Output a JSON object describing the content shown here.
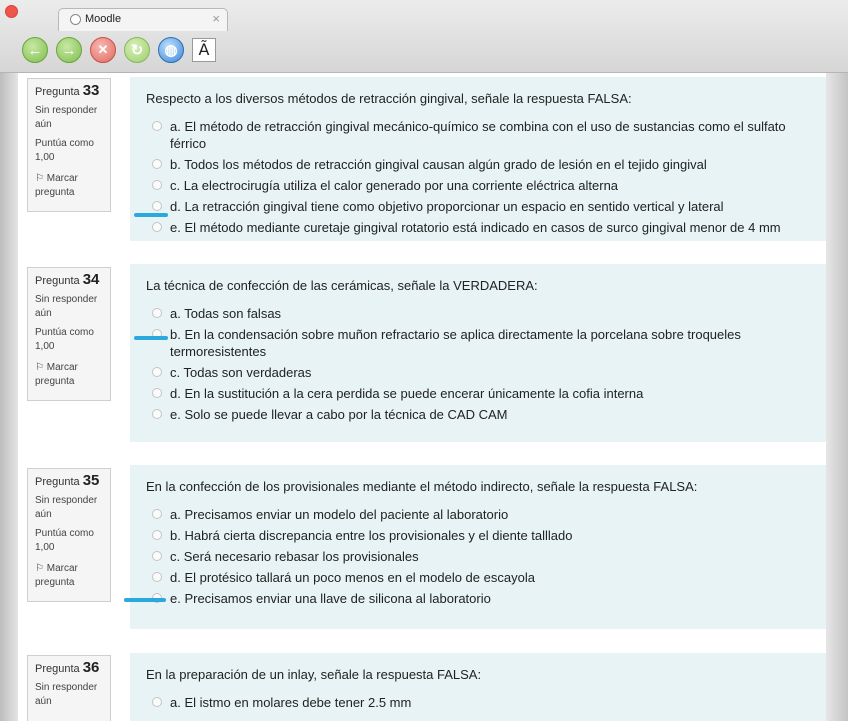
{
  "browser": {
    "tab_title": "Moodle",
    "font_button": "Ã"
  },
  "questions": [
    {
      "label": "Pregunta",
      "number": "33",
      "status": "Sin responder aún",
      "points": "Puntúa como 1,00",
      "flag": "Marcar pregunta",
      "text": "Respecto a los diversos métodos de retracción gingival, señale la respuesta FALSA:",
      "options": [
        "a. El método de retracción gingival mecánico-químico se combina con el uso de sustancias como el sulfato férrico",
        "b. Todos los métodos de retracción gingival causan algún grado de lesión en el tejido gingival",
        "c. La electrocirugía utiliza el calor generado por una corriente eléctrica alterna",
        "d. La retracción gingival tiene como objetivo proporcionar un espacio en sentido vertical y lateral",
        "e. El método mediante curetaje gingival rotatorio está indicado en casos de surco gingival menor de 4 mm"
      ]
    },
    {
      "label": "Pregunta",
      "number": "34",
      "status": "Sin responder aún",
      "points": "Puntúa como 1,00",
      "flag": "Marcar pregunta",
      "text": "La técnica de confección de las cerámicas, señale la VERDADERA:",
      "options": [
        "a. Todas son falsas",
        "b. En la condensación sobre muñon refractario se aplica directamente la porcelana sobre troqueles termoresistentes",
        "c. Todas son verdaderas",
        "d. En la sustitución a la cera perdida se puede encerar únicamente la cofia interna",
        "e. Solo se puede llevar a cabo por la técnica de CAD CAM"
      ]
    },
    {
      "label": "Pregunta",
      "number": "35",
      "status": "Sin responder aún",
      "points": "Puntúa como 1,00",
      "flag": "Marcar pregunta",
      "text": "En la confección de los provisionales mediante el método indirecto, señale la respuesta FALSA:",
      "options": [
        "a. Precisamos enviar un modelo del paciente al laboratorio",
        "b. Habrá cierta discrepancia entre los provisionales y el diente talllado",
        "c. Será necesario rebasar los provisionales",
        "d. El protésico tallará un poco menos en el modelo de escayola",
        "e. Precisamos enviar una llave de silicona al laboratorio"
      ]
    },
    {
      "label": "Pregunta",
      "number": "36",
      "status": "Sin responder aún",
      "text": "En la preparación de un inlay, señale la respuesta FALSA:",
      "options": [
        "a. El istmo en molares debe tener 2.5 mm"
      ]
    }
  ],
  "colors": {
    "question_bg": "#e7f3f5",
    "marker": "#2ba8de"
  }
}
